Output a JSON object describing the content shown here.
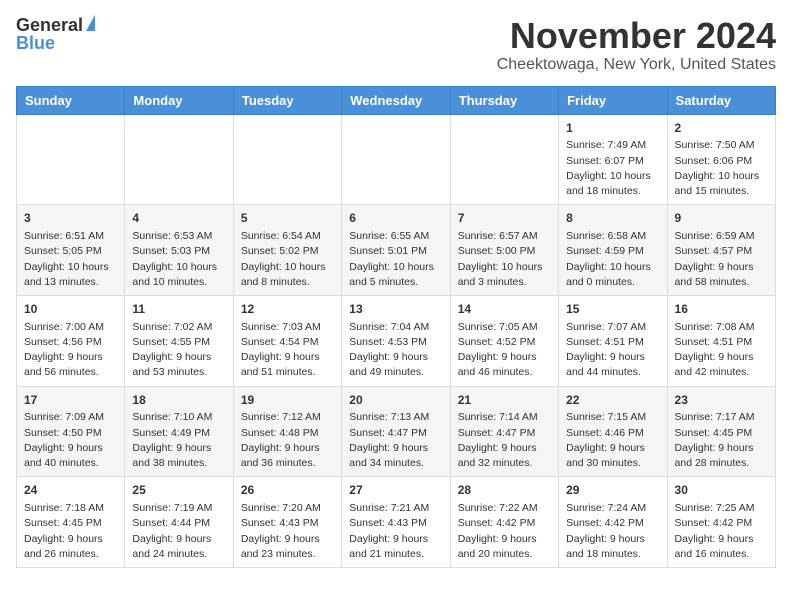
{
  "header": {
    "logo_general": "General",
    "logo_blue": "Blue",
    "title": "November 2024",
    "subtitle": "Cheektowaga, New York, United States"
  },
  "weekdays": [
    "Sunday",
    "Monday",
    "Tuesday",
    "Wednesday",
    "Thursday",
    "Friday",
    "Saturday"
  ],
  "weeks": [
    [
      {
        "day": "",
        "info": ""
      },
      {
        "day": "",
        "info": ""
      },
      {
        "day": "",
        "info": ""
      },
      {
        "day": "",
        "info": ""
      },
      {
        "day": "",
        "info": ""
      },
      {
        "day": "1",
        "info": "Sunrise: 7:49 AM\nSunset: 6:07 PM\nDaylight: 10 hours\nand 18 minutes."
      },
      {
        "day": "2",
        "info": "Sunrise: 7:50 AM\nSunset: 6:06 PM\nDaylight: 10 hours\nand 15 minutes."
      }
    ],
    [
      {
        "day": "3",
        "info": "Sunrise: 6:51 AM\nSunset: 5:05 PM\nDaylight: 10 hours\nand 13 minutes."
      },
      {
        "day": "4",
        "info": "Sunrise: 6:53 AM\nSunset: 5:03 PM\nDaylight: 10 hours\nand 10 minutes."
      },
      {
        "day": "5",
        "info": "Sunrise: 6:54 AM\nSunset: 5:02 PM\nDaylight: 10 hours\nand 8 minutes."
      },
      {
        "day": "6",
        "info": "Sunrise: 6:55 AM\nSunset: 5:01 PM\nDaylight: 10 hours\nand 5 minutes."
      },
      {
        "day": "7",
        "info": "Sunrise: 6:57 AM\nSunset: 5:00 PM\nDaylight: 10 hours\nand 3 minutes."
      },
      {
        "day": "8",
        "info": "Sunrise: 6:58 AM\nSunset: 4:59 PM\nDaylight: 10 hours\nand 0 minutes."
      },
      {
        "day": "9",
        "info": "Sunrise: 6:59 AM\nSunset: 4:57 PM\nDaylight: 9 hours\nand 58 minutes."
      }
    ],
    [
      {
        "day": "10",
        "info": "Sunrise: 7:00 AM\nSunset: 4:56 PM\nDaylight: 9 hours\nand 56 minutes."
      },
      {
        "day": "11",
        "info": "Sunrise: 7:02 AM\nSunset: 4:55 PM\nDaylight: 9 hours\nand 53 minutes."
      },
      {
        "day": "12",
        "info": "Sunrise: 7:03 AM\nSunset: 4:54 PM\nDaylight: 9 hours\nand 51 minutes."
      },
      {
        "day": "13",
        "info": "Sunrise: 7:04 AM\nSunset: 4:53 PM\nDaylight: 9 hours\nand 49 minutes."
      },
      {
        "day": "14",
        "info": "Sunrise: 7:05 AM\nSunset: 4:52 PM\nDaylight: 9 hours\nand 46 minutes."
      },
      {
        "day": "15",
        "info": "Sunrise: 7:07 AM\nSunset: 4:51 PM\nDaylight: 9 hours\nand 44 minutes."
      },
      {
        "day": "16",
        "info": "Sunrise: 7:08 AM\nSunset: 4:51 PM\nDaylight: 9 hours\nand 42 minutes."
      }
    ],
    [
      {
        "day": "17",
        "info": "Sunrise: 7:09 AM\nSunset: 4:50 PM\nDaylight: 9 hours\nand 40 minutes."
      },
      {
        "day": "18",
        "info": "Sunrise: 7:10 AM\nSunset: 4:49 PM\nDaylight: 9 hours\nand 38 minutes."
      },
      {
        "day": "19",
        "info": "Sunrise: 7:12 AM\nSunset: 4:48 PM\nDaylight: 9 hours\nand 36 minutes."
      },
      {
        "day": "20",
        "info": "Sunrise: 7:13 AM\nSunset: 4:47 PM\nDaylight: 9 hours\nand 34 minutes."
      },
      {
        "day": "21",
        "info": "Sunrise: 7:14 AM\nSunset: 4:47 PM\nDaylight: 9 hours\nand 32 minutes."
      },
      {
        "day": "22",
        "info": "Sunrise: 7:15 AM\nSunset: 4:46 PM\nDaylight: 9 hours\nand 30 minutes."
      },
      {
        "day": "23",
        "info": "Sunrise: 7:17 AM\nSunset: 4:45 PM\nDaylight: 9 hours\nand 28 minutes."
      }
    ],
    [
      {
        "day": "24",
        "info": "Sunrise: 7:18 AM\nSunset: 4:45 PM\nDaylight: 9 hours\nand 26 minutes."
      },
      {
        "day": "25",
        "info": "Sunrise: 7:19 AM\nSunset: 4:44 PM\nDaylight: 9 hours\nand 24 minutes."
      },
      {
        "day": "26",
        "info": "Sunrise: 7:20 AM\nSunset: 4:43 PM\nDaylight: 9 hours\nand 23 minutes."
      },
      {
        "day": "27",
        "info": "Sunrise: 7:21 AM\nSunset: 4:43 PM\nDaylight: 9 hours\nand 21 minutes."
      },
      {
        "day": "28",
        "info": "Sunrise: 7:22 AM\nSunset: 4:42 PM\nDaylight: 9 hours\nand 20 minutes."
      },
      {
        "day": "29",
        "info": "Sunrise: 7:24 AM\nSunset: 4:42 PM\nDaylight: 9 hours\nand 18 minutes."
      },
      {
        "day": "30",
        "info": "Sunrise: 7:25 AM\nSunset: 4:42 PM\nDaylight: 9 hours\nand 16 minutes."
      }
    ]
  ]
}
